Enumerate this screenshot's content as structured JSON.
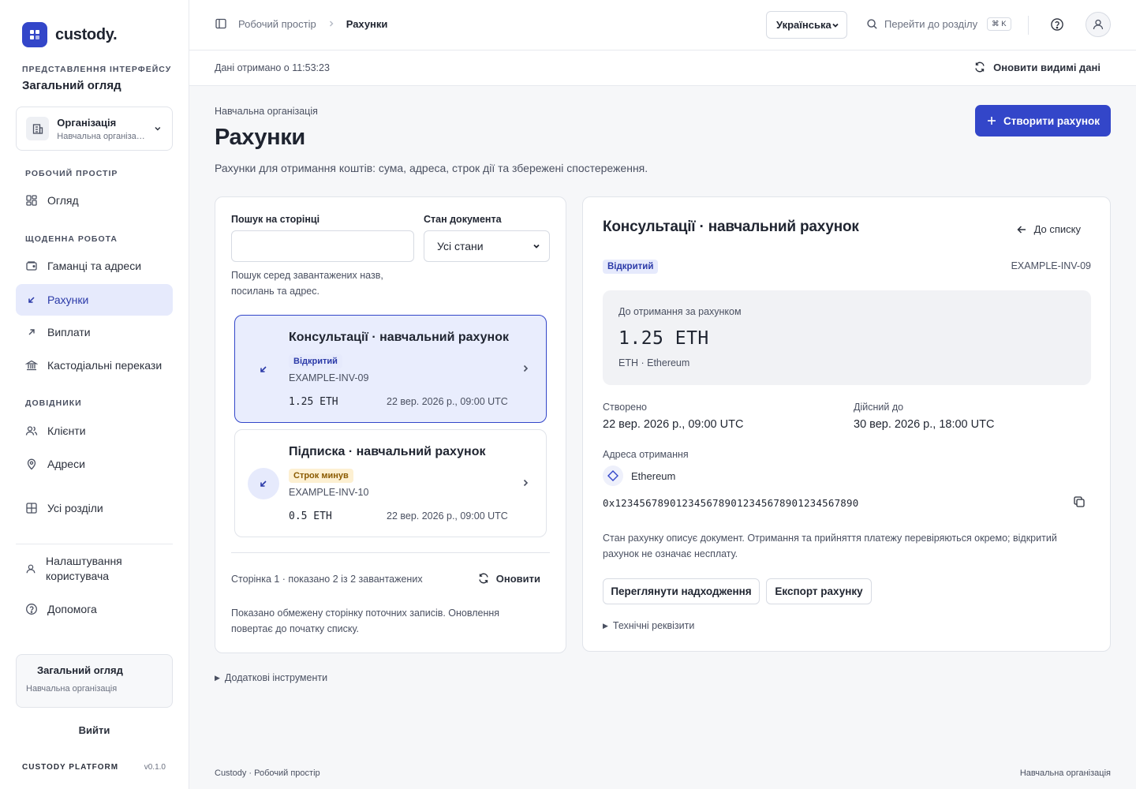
{
  "app": {
    "brand": "custody.",
    "platform": "CUSTODY PLATFORM",
    "version": "v0.1.0"
  },
  "sidebar": {
    "view_section_label": "ПРЕДСТАВЛЕННЯ ІНТЕРФЕЙСУ",
    "view_name": "Загальний огляд",
    "org_switcher": {
      "title": "Організація",
      "subtitle": "Навчальна організація"
    },
    "workspace_label": "РОБОЧИЙ ПРОСТІР",
    "daily_label": "ЩОДЕННА РОБОТА",
    "reference_label": "ДОВІДНИКИ",
    "items": {
      "overview": "Огляд",
      "wallets": "Гаманці та адреси",
      "invoices": "Рахунки",
      "payouts": "Виплати",
      "custodial": "Кастодіальні перекази",
      "clients": "Клієнти",
      "addresses": "Адреси",
      "all_sections": "Усі розділи",
      "user_settings": "Налаштування користувача",
      "help": "Допомога"
    },
    "summary_card": {
      "title": "Загальний огляд",
      "subtitle": "Навчальна організація"
    },
    "logout": "Вийти"
  },
  "header": {
    "breadcrumb_root": "Робочий простір",
    "breadcrumb_current": "Рахунки",
    "language": "Українська",
    "goto_placeholder": "Перейти до розділу",
    "goto_shortcut": "⌘ K"
  },
  "statusbar": {
    "fetched_text": "Дані отримано о 11:53:23",
    "refresh_visible": "Оновити видимі дані"
  },
  "page": {
    "org_crumb": "Навчальна організація",
    "title": "Рахунки",
    "description": "Рахунки для отримання коштів: сума, адреса, строк дії та збережені спостереження.",
    "create_button": "Створити рахунок"
  },
  "filters": {
    "search_label": "Пошук на сторінці",
    "search_value": "",
    "state_label": "Стан документа",
    "state_value": "Усі стани",
    "hint": "Пошук серед завантажених назв, посилань та адрес."
  },
  "invoices": [
    {
      "title": "Консультації · навчальний рахунок",
      "status": "Відкритий",
      "id": "EXAMPLE-INV-09",
      "amount": "1.25 ETH",
      "date": "22 вер. 2026 р., 09:00 UTC"
    },
    {
      "title": "Підписка · навчальний рахунок",
      "status": "Строк минув",
      "id": "EXAMPLE-INV-10",
      "amount": "0.5 ETH",
      "date": "22 вер. 2026 р., 09:00 UTC"
    }
  ],
  "list_footer": {
    "page_info": "Сторінка 1 · показано 2 із 2 завантажених",
    "refresh": "Оновити",
    "note": "Показано обмежену сторінку поточних записів. Оновлення повертає до початку списку."
  },
  "detail": {
    "title": "Консультації · навчальний рахунок",
    "back": "До списку",
    "status": "Відкритий",
    "id": "EXAMPLE-INV-09",
    "amount_label": "До отримання за рахунком",
    "amount": "1.25 ETH",
    "network_line": "ETH · Ethereum",
    "created_label": "Створено",
    "created": "22 вер. 2026 р., 09:00 UTC",
    "valid_label": "Дійсний до",
    "valid": "30 вер. 2026 р., 18:00 UTC",
    "address_label": "Адреса отримання",
    "network": "Ethereum",
    "address": "0x1234567890123456789012345678901234567890",
    "note": "Стан рахунку описує документ. Отримання та прийняття платежу перевіряються окремо; відкритий рахунок не означає несплату.",
    "view_receipts": "Переглянути надходження",
    "export": "Експорт рахунку",
    "tech_details": "Технічні реквізити"
  },
  "extra_tools": "Додаткові інструменти",
  "footer": {
    "left": "Custody · Робочий простір",
    "right": "Навчальна організація"
  },
  "colors": {
    "accent": "#3346c9",
    "accent_soft": "#e6eafc",
    "warning_soft": "#fdf0d2"
  }
}
